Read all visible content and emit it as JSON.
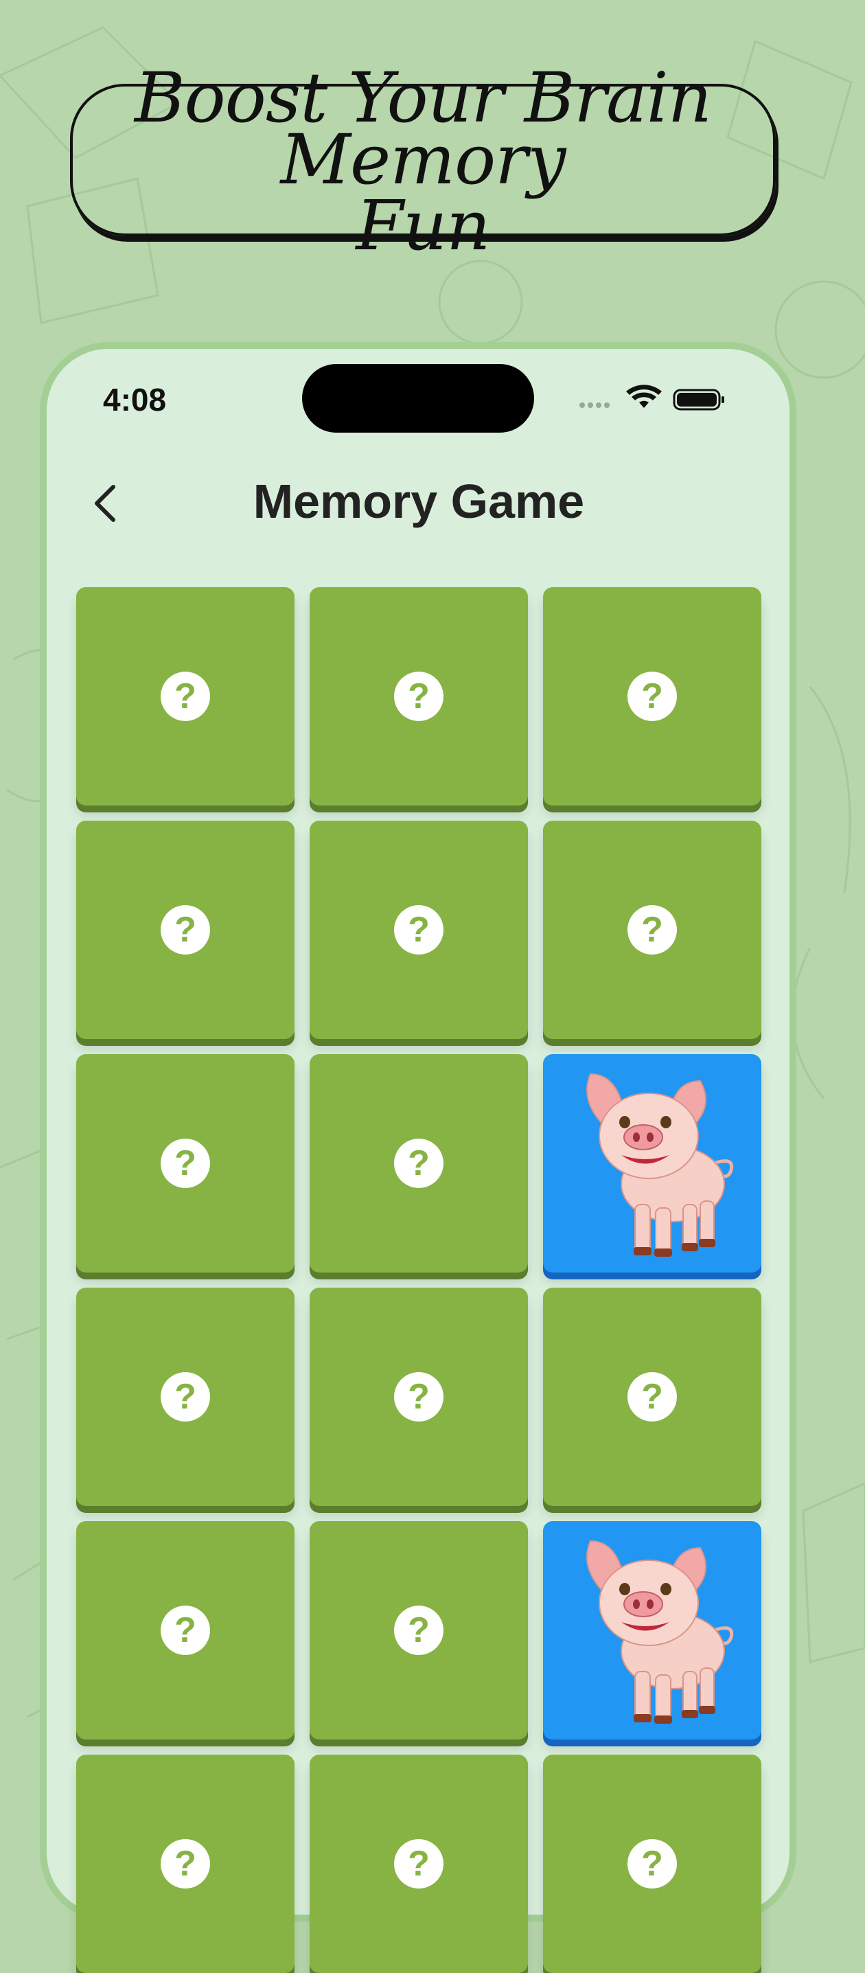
{
  "headline": {
    "line1": "Boost Your Brain Memory",
    "line2": "Fun"
  },
  "status_bar": {
    "time": "4:08"
  },
  "header": {
    "title": "Memory Game"
  },
  "cards": [
    {
      "state": "hidden",
      "symbol": "?"
    },
    {
      "state": "hidden",
      "symbol": "?"
    },
    {
      "state": "hidden",
      "symbol": "?"
    },
    {
      "state": "hidden",
      "symbol": "?"
    },
    {
      "state": "hidden",
      "symbol": "?"
    },
    {
      "state": "hidden",
      "symbol": "?"
    },
    {
      "state": "hidden",
      "symbol": "?"
    },
    {
      "state": "hidden",
      "symbol": "?"
    },
    {
      "state": "revealed",
      "image": "pig-icon"
    },
    {
      "state": "hidden",
      "symbol": "?"
    },
    {
      "state": "hidden",
      "symbol": "?"
    },
    {
      "state": "hidden",
      "symbol": "?"
    },
    {
      "state": "hidden",
      "symbol": "?"
    },
    {
      "state": "hidden",
      "symbol": "?"
    },
    {
      "state": "revealed",
      "image": "pig-icon"
    },
    {
      "state": "hidden",
      "symbol": "?"
    },
    {
      "state": "hidden",
      "symbol": "?"
    },
    {
      "state": "hidden",
      "symbol": "?"
    }
  ],
  "colors": {
    "background": "#b7d6ab",
    "phone": "#d9eedb",
    "card_hidden": "#86b343",
    "card_revealed": "#2196f3"
  }
}
